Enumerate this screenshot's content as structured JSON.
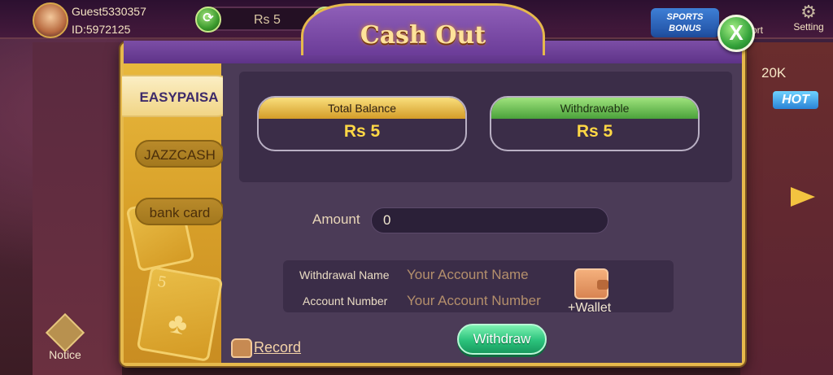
{
  "lobby": {
    "guest_name": "Guest5330357",
    "guest_id": "ID:5972125",
    "balance": "Rs  5",
    "sports_bonus": "SPORTS BONUS",
    "short_label": "ort",
    "setting_label": "Setting",
    "jackpot": "20K",
    "hot_tag": "HOT",
    "notice_label": "Notice"
  },
  "modal": {
    "title": "Cash Out",
    "close_symbol": "X",
    "tabs": [
      {
        "label": "EASYPAISA",
        "active": true
      },
      {
        "label": "JAZZCASH",
        "active": false
      },
      {
        "label": "bank card",
        "active": false
      }
    ],
    "card_number": "5",
    "total_balance": {
      "label": "Total Balance",
      "value": "Rs  5"
    },
    "withdrawable": {
      "label": "Withdrawable",
      "value": "Rs  5"
    },
    "amount": {
      "label": "Amount",
      "value": "0"
    },
    "withdrawal_name": {
      "label": "Withdrawal Name",
      "placeholder": "Your Account Name"
    },
    "account_number": {
      "label": "Account Number",
      "placeholder": "Your Account Number"
    },
    "wallet_label": "+Wallet",
    "withdraw_button": "Withdraw",
    "record_label": "Record"
  },
  "colors": {
    "gold": "#e6b94c",
    "purple": "#6b3c98",
    "green": "#2bc27c",
    "value_yellow": "#ffd845"
  }
}
